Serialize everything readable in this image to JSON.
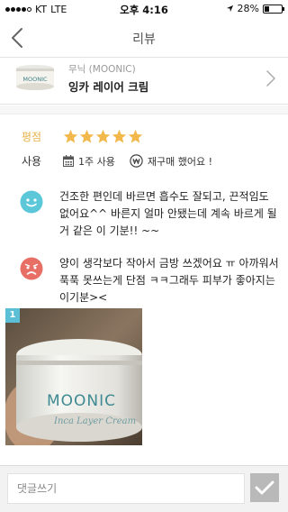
{
  "status_bar": {
    "carrier": "KT",
    "network": "LTE",
    "time": "오후 4:16",
    "battery": "28%",
    "battery_level": 0.28
  },
  "nav": {
    "title": "리뷰",
    "back_icon": "chevron-left-icon"
  },
  "product": {
    "brand": "무닉 (MOONIC)",
    "name": "잉카 레이어 크림",
    "thumb_label": "MOONIC"
  },
  "review": {
    "rating_label": "평점",
    "rating": 5,
    "rating_max": 5,
    "usage_label": "사용",
    "usage_period": "1주 사용",
    "repurchase": "재구매 했어요 !"
  },
  "comments": [
    {
      "face": "happy-face-icon",
      "text": "건조한 편인데 바르면 흡수도 잘되고, 끈적임도 없어요^^ 바른지 얼마 안됐는데 계속 바르게 될거 같은 이 기분!! ~~"
    },
    {
      "face": "sad-face-icon",
      "text": "양이 생각보다 작아서 금방 쓰겠어요 ㅠ 아까워서 푹푹 못쓰는게 단점 ㅋㅋ그래두 피부가 좋아지는 이기분><"
    }
  ],
  "photo": {
    "index": "1",
    "jar_brand": "MOONIC",
    "jar_product": "Inca Layer Cream"
  },
  "comment_box": {
    "placeholder": "댓글쓰기"
  },
  "colors": {
    "accent_gold": "#e8b24a",
    "star": "#f2b84b",
    "happy_face": "#5bc7d9",
    "sad_face": "#e76f66",
    "badge": "#5bbfd6"
  }
}
